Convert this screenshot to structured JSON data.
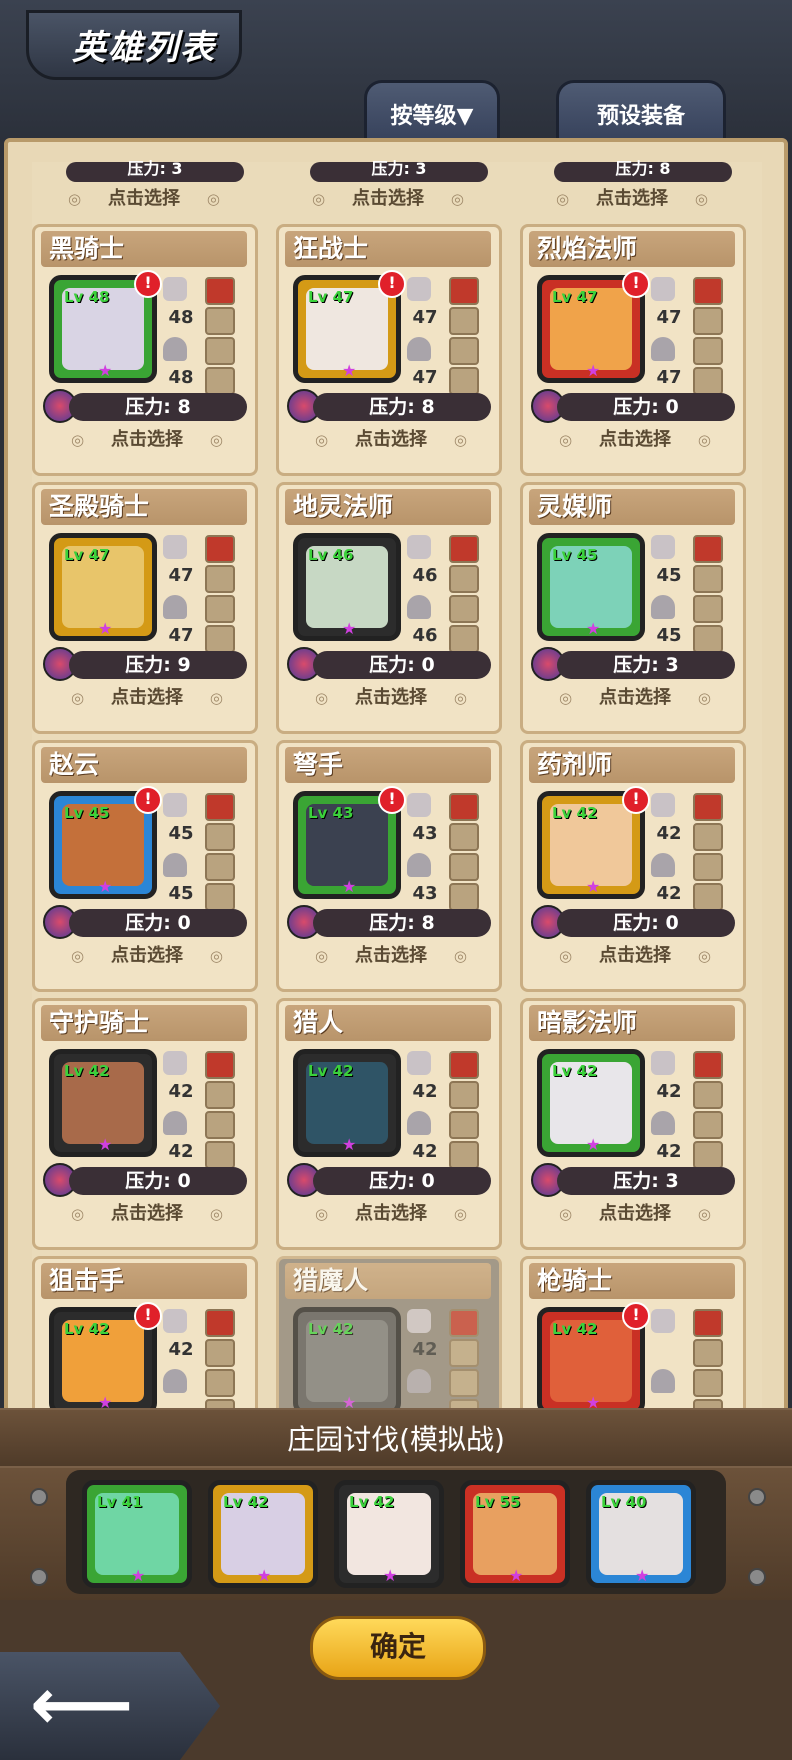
{
  "header": {
    "title": "英雄列表",
    "sort_tab": "按等级▼",
    "preset_tab": "预设装备"
  },
  "partial_top": {
    "stress_labels": [
      "压力: 3",
      "压力: 3",
      "压力: 8"
    ],
    "select_label": "点击选择"
  },
  "heroes": [
    {
      "name": "黑骑士",
      "level": "Lv 48",
      "weapon": "48",
      "armor": "48",
      "stress": "压力: 8",
      "select": "点击选择",
      "frame_color": "#3aa534",
      "face_color": "#d9d4e4",
      "alert": true
    },
    {
      "name": "狂战士",
      "level": "Lv 47",
      "weapon": "47",
      "armor": "47",
      "stress": "压力: 8",
      "select": "点击选择",
      "frame_color": "#d49a16",
      "face_color": "#efe7e0",
      "alert": true
    },
    {
      "name": "烈焰法师",
      "level": "Lv 47",
      "weapon": "47",
      "armor": "47",
      "stress": "压力: 0",
      "select": "点击选择",
      "frame_color": "#c93024",
      "face_color": "#f0a34a",
      "alert": true
    },
    {
      "name": "圣殿骑士",
      "level": "Lv 47",
      "weapon": "47",
      "armor": "47",
      "stress": "压力: 9",
      "select": "点击选择",
      "frame_color": "#d49a16",
      "face_color": "#e8c56a",
      "alert": false
    },
    {
      "name": "地灵法师",
      "level": "Lv 46",
      "weapon": "46",
      "armor": "46",
      "stress": "压力: 0",
      "select": "点击选择",
      "frame_color": "#2c2c2c",
      "face_color": "#c7d8c4",
      "alert": false
    },
    {
      "name": "灵媒师",
      "level": "Lv 45",
      "weapon": "45",
      "armor": "45",
      "stress": "压力: 3",
      "select": "点击选择",
      "frame_color": "#3aa534",
      "face_color": "#7dd2b8",
      "alert": false
    },
    {
      "name": "赵云",
      "level": "Lv 45",
      "weapon": "45",
      "armor": "45",
      "stress": "压力: 0",
      "select": "点击选择",
      "frame_color": "#2b86d6",
      "face_color": "#c4703a",
      "alert": true
    },
    {
      "name": "弩手",
      "level": "Lv 43",
      "weapon": "43",
      "armor": "43",
      "stress": "压力: 8",
      "select": "点击选择",
      "frame_color": "#3aa534",
      "face_color": "#3b4150",
      "alert": true
    },
    {
      "name": "药剂师",
      "level": "Lv 42",
      "weapon": "42",
      "armor": "42",
      "stress": "压力: 0",
      "select": "点击选择",
      "frame_color": "#d49a16",
      "face_color": "#f0c89a",
      "alert": true
    },
    {
      "name": "守护骑士",
      "level": "Lv 42",
      "weapon": "42",
      "armor": "42",
      "stress": "压力: 0",
      "select": "点击选择",
      "frame_color": "#2c2c2c",
      "face_color": "#a86a4a",
      "alert": false
    },
    {
      "name": "猎人",
      "level": "Lv 42",
      "weapon": "42",
      "armor": "42",
      "stress": "压力: 0",
      "select": "点击选择",
      "frame_color": "#2c2c2c",
      "face_color": "#2f5466",
      "alert": false
    },
    {
      "name": "暗影法师",
      "level": "Lv 42",
      "weapon": "42",
      "armor": "42",
      "stress": "压力: 3",
      "select": "点击选择",
      "frame_color": "#3aa534",
      "face_color": "#e8e6ea",
      "alert": false
    },
    {
      "name": "狙击手",
      "level": "Lv 42",
      "weapon": "42",
      "armor": "",
      "stress": "",
      "select": "",
      "frame_color": "#2c2c2c",
      "face_color": "#f0a03a",
      "alert": true
    },
    {
      "name": "猎魔人",
      "level": "Lv 42",
      "weapon": "42",
      "armor": "",
      "stress": "",
      "select": "",
      "frame_color": "#555",
      "face_color": "#777",
      "alert": false,
      "disabled": true
    },
    {
      "name": "枪骑士",
      "level": "Lv 42",
      "weapon": "",
      "armor": "",
      "stress": "",
      "select": "",
      "frame_color": "#c93024",
      "face_color": "#e0603a",
      "alert": true
    }
  ],
  "team": {
    "title": "庄园讨伐(模拟战)",
    "members": [
      {
        "level": "Lv 41",
        "frame_color": "#3aa534",
        "face_color": "#6fd6a4"
      },
      {
        "level": "Lv 42",
        "frame_color": "#d49a16",
        "face_color": "#d8cfe4"
      },
      {
        "level": "Lv 42",
        "frame_color": "#2c2c2c",
        "face_color": "#f2e6e0"
      },
      {
        "level": "Lv 55",
        "frame_color": "#c93024",
        "face_color": "#e8a060"
      },
      {
        "level": "Lv 40",
        "frame_color": "#2b86d6",
        "face_color": "#e4e0e0"
      }
    ],
    "confirm_label": "确定"
  },
  "back_label": "⟵"
}
